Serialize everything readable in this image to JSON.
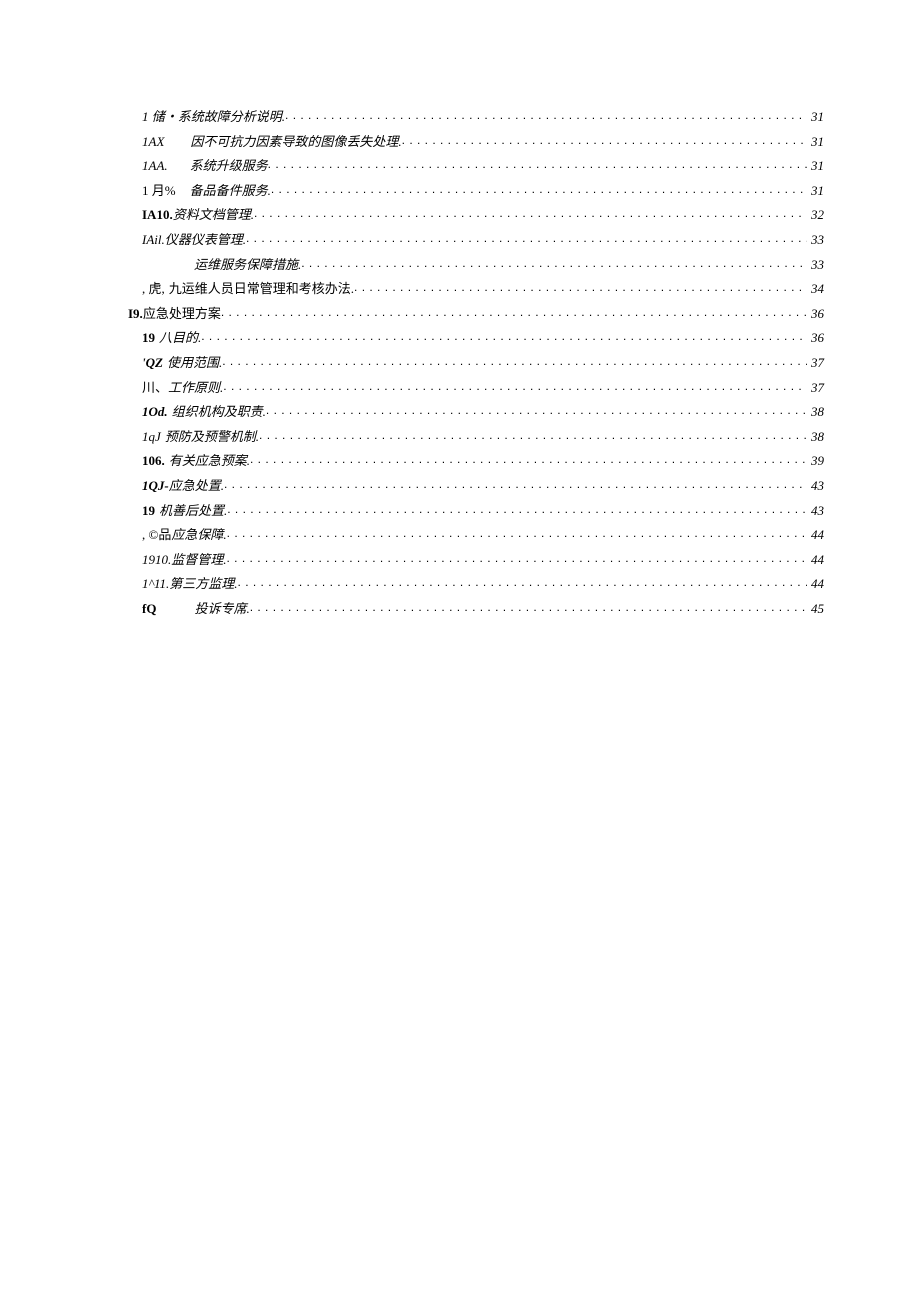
{
  "toc": [
    {
      "level": 2,
      "prefix": "1 储・",
      "prefixClass": "",
      "gap": 0,
      "title": "系统故障分析说明.",
      "titleClass": "",
      "page": "31"
    },
    {
      "level": 2,
      "prefix": "1AX",
      "prefixClass": "",
      "gap": 26,
      "title": "因不可抗力因素导致的图像丢失处理.",
      "titleClass": "",
      "page": "31"
    },
    {
      "level": 2,
      "prefix": "1AA.",
      "prefixClass": "",
      "gap": 22,
      "title": "系统升级服务",
      "titleClass": "",
      "page": "31"
    },
    {
      "level": 2,
      "prefix": "1 月%",
      "prefixClass": "upright",
      "gap": 14,
      "title": "备品备件服务.",
      "titleClass": "",
      "page": "31"
    },
    {
      "level": 2,
      "prefix": "IA10.",
      "prefixClass": "bold",
      "gap": 0,
      "title": "资料文档管理.",
      "titleClass": "",
      "page": "32"
    },
    {
      "level": 2,
      "prefix": "IAil.",
      "prefixClass": "",
      "gap": 0,
      "title": "仪器仪表管理.",
      "titleClass": "",
      "page": "33"
    },
    {
      "level": 3,
      "prefix": "",
      "prefixClass": "",
      "gap": 0,
      "title": "运维服务保障措施.",
      "titleClass": "",
      "page": "33"
    },
    {
      "level": 2,
      "prefix": ", 虎,",
      "prefixClass": "upright",
      "gap": 4,
      "title": "九运维人员日常管理和考核办法.",
      "titleClass": "upright",
      "page": "34",
      "pageClass": "upright"
    },
    {
      "level": 1,
      "prefix": "I9.",
      "prefixClass": "bold",
      "gap": 0,
      "title": "应急处理方案",
      "titleClass": "upright",
      "page": "36",
      "pageClass": "upright"
    },
    {
      "level": 2,
      "prefix": "19",
      "prefixClass": "bold",
      "gap": 4,
      "title": "八目的.",
      "titleClass": "",
      "page": "36"
    },
    {
      "level": 2,
      "prefix": "'QZ",
      "prefixClass": "ibold",
      "gap": 4,
      "title": "使用范围.",
      "titleClass": "",
      "page": "37"
    },
    {
      "level": 2,
      "prefix": "川、",
      "prefixClass": "upright",
      "gap": 0,
      "title": "工作原则.",
      "titleClass": "",
      "page": "37"
    },
    {
      "level": 2,
      "prefix": "1Od.",
      "prefixClass": "ibold",
      "gap": 4,
      "title": "组织机构及职责.",
      "titleClass": "",
      "page": "38"
    },
    {
      "level": 2,
      "prefix": "1qJ",
      "prefixClass": "",
      "gap": 4,
      "title": "预防及预警机制.",
      "titleClass": "",
      "page": "38"
    },
    {
      "level": 2,
      "prefix": "106.",
      "prefixClass": "bold",
      "gap": 4,
      "title": "有关应急预案.",
      "titleClass": "",
      "page": "39"
    },
    {
      "level": 2,
      "prefix": "1QJ-",
      "prefixClass": "ibold",
      "gap": 0,
      "title": "应急处置.",
      "titleClass": "",
      "page": "43"
    },
    {
      "level": 2,
      "prefix": "19",
      "prefixClass": "bold",
      "gap": 4,
      "title": "机善后处置.",
      "titleClass": "",
      "page": "43"
    },
    {
      "level": 2,
      "prefix": ", ©品",
      "prefixClass": "upright",
      "gap": 0,
      "title": "应急保障.",
      "titleClass": "",
      "page": "44"
    },
    {
      "level": 2,
      "prefix": "1910.",
      "prefixClass": "",
      "gap": 0,
      "title": "监督管理.",
      "titleClass": "",
      "page": "44"
    },
    {
      "level": 2,
      "prefix": "1^11.",
      "prefixClass": "",
      "gap": 0,
      "title": "第三方监理.",
      "titleClass": "",
      "page": "44"
    },
    {
      "level": 2,
      "prefix": "fQ",
      "prefixClass": "bold",
      "gap": 38,
      "title": "投诉专席.",
      "titleClass": "",
      "page": "45"
    }
  ]
}
